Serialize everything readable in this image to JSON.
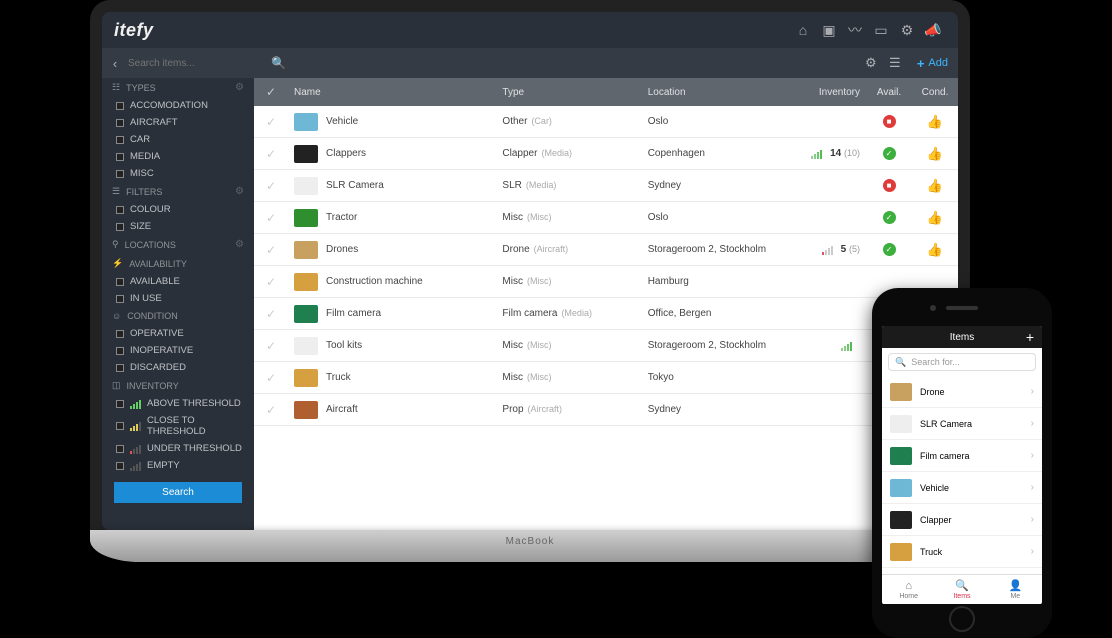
{
  "brand": "itefy",
  "laptop_model": "MacBook",
  "search_placeholder": "Search items...",
  "add_label": "Add",
  "search_button": "Search",
  "sidebar": {
    "groups": [
      {
        "title": "TYPES",
        "gear": true,
        "items": [
          {
            "label": "ACCOMODATION"
          },
          {
            "label": "AIRCRAFT"
          },
          {
            "label": "CAR"
          },
          {
            "label": "MEDIA"
          },
          {
            "label": "MISC"
          }
        ]
      },
      {
        "title": "FILTERS",
        "gear": true,
        "items": [
          {
            "label": "COLOUR"
          },
          {
            "label": "SIZE"
          }
        ]
      },
      {
        "title": "LOCATIONS",
        "gear": true,
        "items": []
      },
      {
        "title": "AVAILABILITY",
        "items": [
          {
            "label": "AVAILABLE"
          },
          {
            "label": "IN USE"
          }
        ]
      },
      {
        "title": "CONDITION",
        "items": [
          {
            "label": "OPERATIVE"
          },
          {
            "label": "INOPERATIVE"
          },
          {
            "label": "DISCARDED"
          }
        ]
      },
      {
        "title": "INVENTORY",
        "items": [
          {
            "label": "ABOVE THRESHOLD",
            "bars": "green"
          },
          {
            "label": "CLOSE TO THRESHOLD",
            "bars": "yellow"
          },
          {
            "label": "UNDER THRESHOLD",
            "bars": "red"
          },
          {
            "label": "EMPTY",
            "bars": "gray"
          }
        ]
      }
    ]
  },
  "table": {
    "columns": {
      "name": "Name",
      "type": "Type",
      "location": "Location",
      "inventory": "Inventory",
      "avail": "Avail.",
      "cond": "Cond."
    },
    "rows": [
      {
        "name": "Vehicle",
        "type": "Other",
        "type_sub": "(Car)",
        "location": "Oslo",
        "avail": "red",
        "cond": "up",
        "thumb": "#6eb8d6"
      },
      {
        "name": "Clappers",
        "type": "Clapper",
        "type_sub": "(Media)",
        "location": "Copenhagen",
        "sig": "green",
        "inv": "14",
        "inv_sub": "(10)",
        "avail": "green",
        "cond": "up",
        "thumb": "#222"
      },
      {
        "name": "SLR Camera",
        "type": "SLR",
        "type_sub": "(Media)",
        "location": "Sydney",
        "avail": "red",
        "cond": "up",
        "thumb": "#eee"
      },
      {
        "name": "Tractor",
        "type": "Misc",
        "type_sub": "(Misc)",
        "location": "Oslo",
        "avail": "green",
        "cond": "up",
        "thumb": "#2f8f2f"
      },
      {
        "name": "Drones",
        "type": "Drone",
        "type_sub": "(Aircraft)",
        "location": "Storageroom 2, Stockholm",
        "sig": "red",
        "inv": "5",
        "inv_sub": "(5)",
        "avail": "green",
        "cond": "up",
        "thumb": "#c8a060"
      },
      {
        "name": "Construction machine",
        "type": "Misc",
        "type_sub": "(Misc)",
        "location": "Hamburg",
        "thumb": "#d6a040"
      },
      {
        "name": "Film camera",
        "type": "Film camera",
        "type_sub": "(Media)",
        "location": "Office, Bergen",
        "thumb": "#1f7f4f"
      },
      {
        "name": "Tool kits",
        "type": "Misc",
        "type_sub": "(Misc)",
        "location": "Storageroom 2, Stockholm",
        "sig": "green",
        "thumb": "#eee"
      },
      {
        "name": "Truck",
        "type": "Misc",
        "type_sub": "(Misc)",
        "location": "Tokyo",
        "thumb": "#d6a040"
      },
      {
        "name": "Aircraft",
        "type": "Prop",
        "type_sub": "(Aircraft)",
        "location": "Sydney",
        "thumb": "#b06030"
      }
    ]
  },
  "mobile": {
    "title": "Items",
    "search_placeholder": "Search for...",
    "tabs": {
      "home": "Home",
      "items": "Items",
      "me": "Me"
    },
    "items": [
      {
        "label": "Drone",
        "thumb": "#c8a060"
      },
      {
        "label": "SLR Camera",
        "thumb": "#eee"
      },
      {
        "label": "Film camera",
        "thumb": "#1f7f4f"
      },
      {
        "label": "Vehicle",
        "thumb": "#6eb8d6"
      },
      {
        "label": "Clapper",
        "thumb": "#222"
      },
      {
        "label": "Truck",
        "thumb": "#d6a040"
      }
    ]
  }
}
